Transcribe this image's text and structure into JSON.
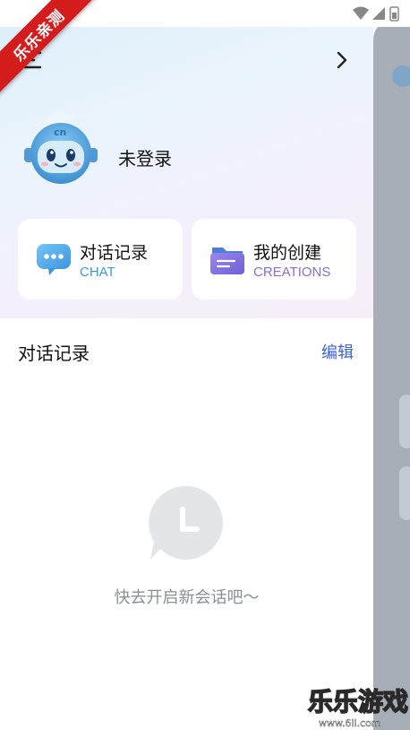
{
  "status_bar": {
    "icons": [
      "wifi-icon",
      "signal-icon",
      "battery-icon"
    ]
  },
  "ribbon": {
    "text": "乐乐亲测"
  },
  "header": {
    "menu_icon": "menu-icon",
    "forward_icon": "chevron-right-icon"
  },
  "profile": {
    "name": "未登录"
  },
  "cards": [
    {
      "title": "对话记录",
      "subtitle": "CHAT",
      "subtitle_color": "#3a9bdc",
      "icon": "chat-bubble-icon"
    },
    {
      "title": "我的创建",
      "subtitle": "CREATIONS",
      "subtitle_color": "#8b6cd9",
      "icon": "folder-icon"
    }
  ],
  "history": {
    "title": "对话记录",
    "edit_label": "编辑"
  },
  "empty_state": {
    "icon": "clock-bubble-icon",
    "text": "快去开启新会话吧～"
  },
  "watermark": {
    "text": "乐乐游戏",
    "url": "www.6ll.com"
  }
}
